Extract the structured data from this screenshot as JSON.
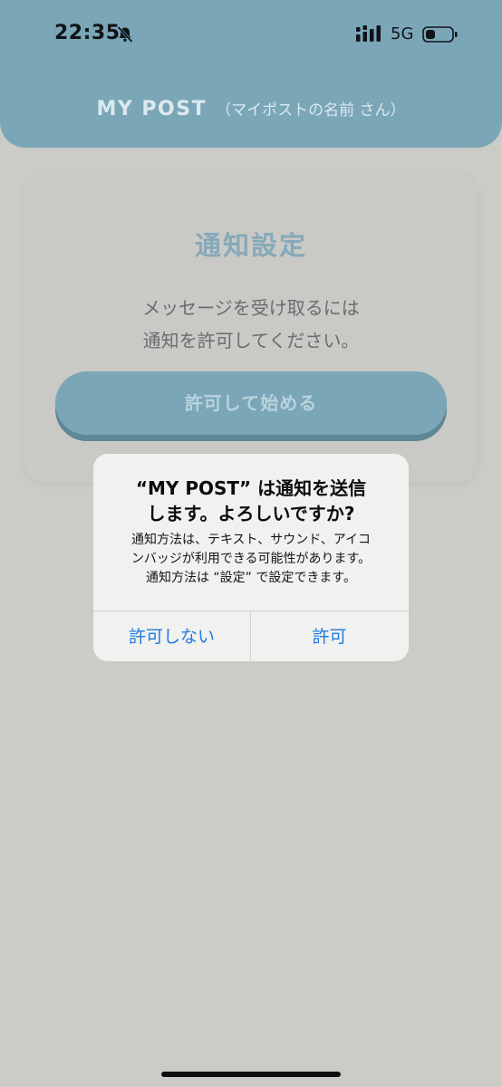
{
  "status_bar": {
    "time": "22:35",
    "network": "5G"
  },
  "header": {
    "app_name": "MY POST",
    "subtitle": "（マイポストの名前 さん）"
  },
  "card": {
    "title": "通知設定",
    "message_line1": "メッセージを受け取るには",
    "message_line2": "通知を許可してください。",
    "start_button": "許可して始める"
  },
  "alert": {
    "title_line1": "“MY POST” は通知を送信",
    "title_line2": "します。よろしいですか?",
    "message_line1": "通知方法は、テキスト、サウンド、アイコ",
    "message_line2": "ンバッジが利用できる可能性があります。",
    "message_line3": "通知方法は “設定” で設定できます。",
    "deny_label": "許可しない",
    "allow_label": "許可"
  },
  "colors": {
    "header": "#7ba6b8",
    "background": "#cbcbc7",
    "alert_button": "#1f7ae0"
  }
}
